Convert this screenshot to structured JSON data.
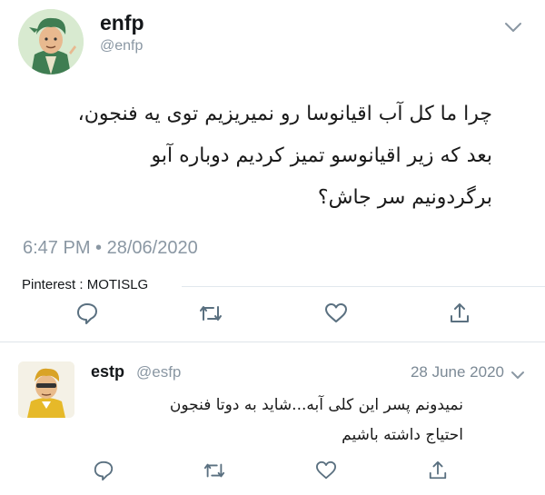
{
  "tweet": {
    "display_name": "enfp",
    "handle": "@enfp",
    "text_lines": [
      "چرا ما کل آب اقیانوسا رو نمیریزیم توی یه فنجون،",
      "بعد که زیر اقیانوسو تمیز کردیم دوباره آبو",
      "برگردونیم سر جاش؟"
    ],
    "timestamp": "6:47 PM • 28/06/2020",
    "source_label": "Pinterest : MOTISLG"
  },
  "reply": {
    "display_name": "estp",
    "handle": "@esfp",
    "date": "28 June 2020",
    "text_lines": [
      "نمیدونم پسر این کلی آبه...شاید به دوتا فنجون",
      "احتیاج داشته باشیم"
    ]
  },
  "icons": {
    "reply": "reply-icon",
    "retweet": "retweet-icon",
    "like": "heart-icon",
    "share": "share-icon",
    "more": "chevron-down-icon"
  },
  "colors": {
    "icon_gray": "#5a7080",
    "muted_text": "#8a97a3",
    "divider": "#e1e8ed"
  }
}
